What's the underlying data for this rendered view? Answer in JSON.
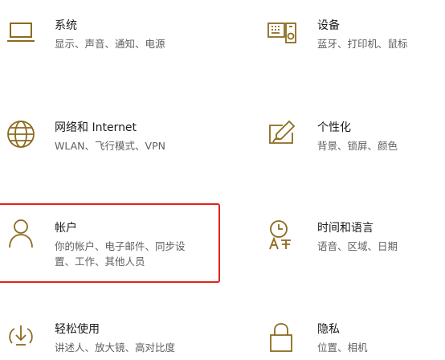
{
  "settings": {
    "accent": "#8c6b1f",
    "highlight_color": "#e2231a",
    "tiles": [
      {
        "title": "系统",
        "desc": [
          "显示、声音、通知、电源"
        ],
        "icon": "laptop-icon"
      },
      {
        "title": "设备",
        "desc": [
          "蓝牙、打印机、鼠标"
        ],
        "icon": "devices-icon"
      },
      {
        "title": "网络和 Internet",
        "desc": [
          "WLAN、飞行模式、VPN"
        ],
        "icon": "globe-icon"
      },
      {
        "title": "个性化",
        "desc": [
          "背景、锁屏、颜色"
        ],
        "icon": "personalization-icon"
      },
      {
        "title": "帐户",
        "desc": [
          "你的帐户、电子邮件、同步设",
          "置、工作、其他人员"
        ],
        "icon": "person-icon"
      },
      {
        "title": "时间和语言",
        "desc": [
          "语音、区域、日期"
        ],
        "icon": "time-language-icon"
      },
      {
        "title": "轻松使用",
        "desc": [
          "讲述人、放大镜、高对比度"
        ],
        "icon": "ease-of-access-icon"
      },
      {
        "title": "隐私",
        "desc": [
          "位置、相机"
        ],
        "icon": "lock-icon"
      }
    ]
  }
}
